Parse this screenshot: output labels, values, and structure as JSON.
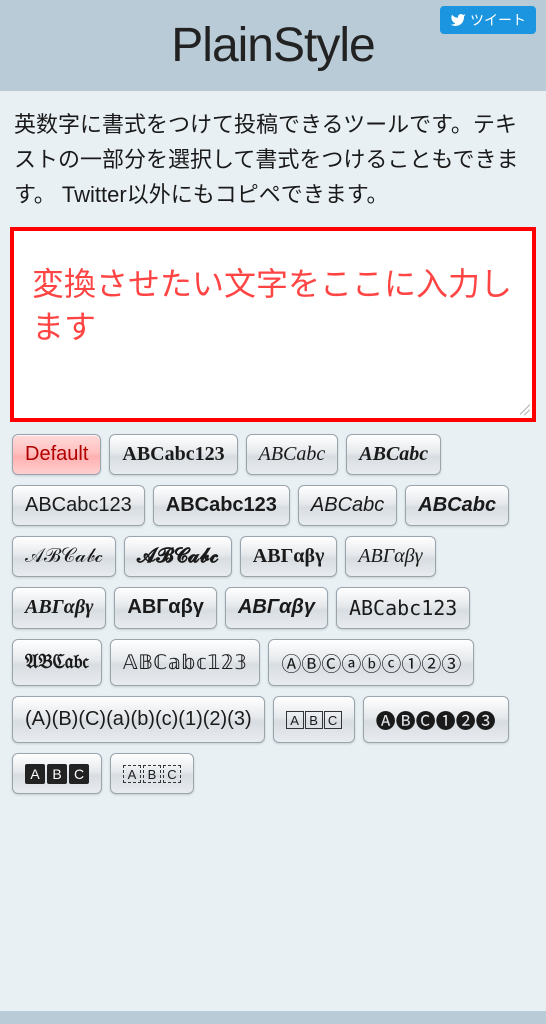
{
  "tweet_button": "ツイート",
  "title": "PlainStyle",
  "description": "英数字に書式をつけて投稿できるツールです。テキストの一部分を選択して書式をつけることもできます。 Twitter以外にもコピペできます。",
  "input_placeholder": "変換させたい文字をここに入力します",
  "buttons": {
    "default": "Default",
    "serif_bold": "ABCabc123",
    "serif_italic": "ABCabc",
    "serif_bold_italic": "ABCabc",
    "sans": "ABCabc123",
    "sans_bold": "ABCabc123",
    "sans_italic": "ABCabc",
    "sans_bold_italic": "ABCabc",
    "script": "𝒜ℬ𝒞𝒶𝒷𝒸",
    "script_bold": "𝓐𝓑𝓒𝓪𝓫𝓬",
    "greek_bold": "ΑΒΓαβγ",
    "greek_italic": "ΑΒΓαβγ",
    "greek_bold_italic": "ΑΒΓαβγ",
    "greek_sans_bold": "ΑΒΓαβγ",
    "greek_sans_bold_italic": "ΑΒΓαβγ",
    "monospace": "ABCabc123",
    "fraktur": "𝔄𝔅ℭ𝔞𝔟𝔠",
    "doublestruck": "𝔸𝔹ℂ𝕒𝕓𝕔𝟙𝟚𝟛",
    "circled": "ⒶⒷⒸⓐⓑⓒ①②③",
    "parenthesized": "(A)(B)(C)(a)(b)(c)(1)(2)(3)",
    "squared": [
      "A",
      "B",
      "C"
    ],
    "neg_circled": "🅐🅑🅒➊➋➌",
    "neg_squared": [
      "A",
      "B",
      "C"
    ],
    "dotted_squared": [
      "A",
      "B",
      "C"
    ]
  }
}
